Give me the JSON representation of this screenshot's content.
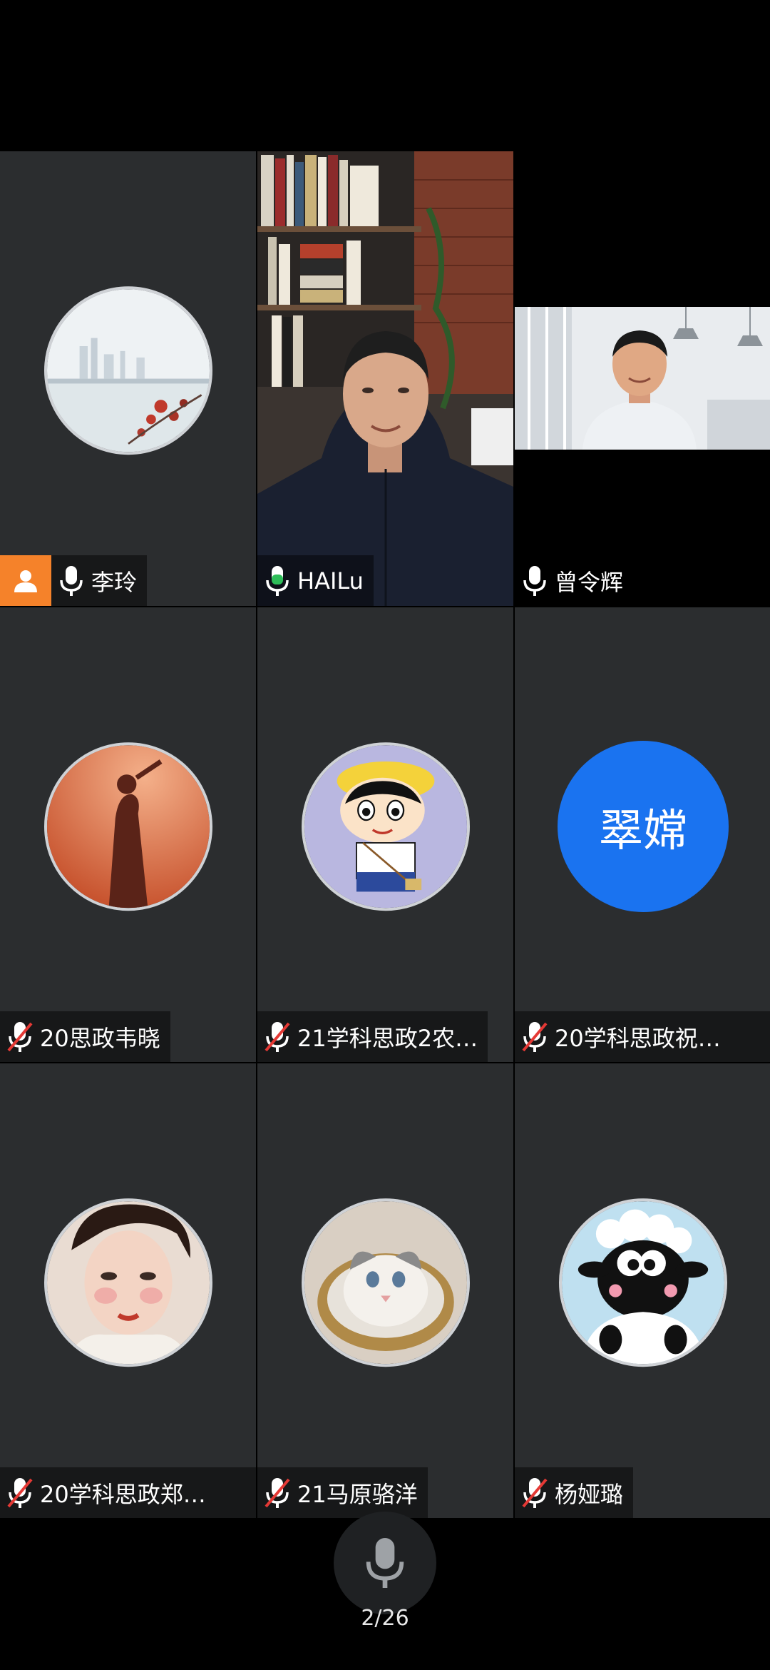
{
  "participants": [
    {
      "name": "李玲",
      "mic": "on",
      "avatar": "city-skyline-photo",
      "host": true
    },
    {
      "name": "HAILu",
      "mic": "active",
      "avatar": "video-bookshelf-man",
      "active_speaker": true
    },
    {
      "name": "曾令辉",
      "mic": "on",
      "avatar": "video-office-man"
    },
    {
      "name": "20思政韦晓",
      "mic": "muted",
      "avatar": "silhouette-sunset-photo"
    },
    {
      "name": "21学科思政2农…",
      "mic": "muted",
      "avatar": "cartoon-boy-yellow-hat"
    },
    {
      "name": "20学科思政祝…",
      "mic": "muted",
      "avatar": "initials",
      "initials": "翠嫦",
      "avatar_color": "#1a73f0"
    },
    {
      "name": "20学科思政郑…",
      "mic": "muted",
      "avatar": "opera-woman-photo"
    },
    {
      "name": "21马原骆洋",
      "mic": "muted",
      "avatar": "cat-photo"
    },
    {
      "name": "杨娅璐",
      "mic": "muted",
      "avatar": "cartoon-sheep"
    }
  ],
  "footer": {
    "page_indicator": "2/26",
    "mic_icon": "microphone-icon"
  },
  "colors": {
    "tile_bg": "#2b2d2f",
    "active_border": "#2ebd59",
    "host_badge": "#f5822a",
    "muted": "#e53935"
  }
}
